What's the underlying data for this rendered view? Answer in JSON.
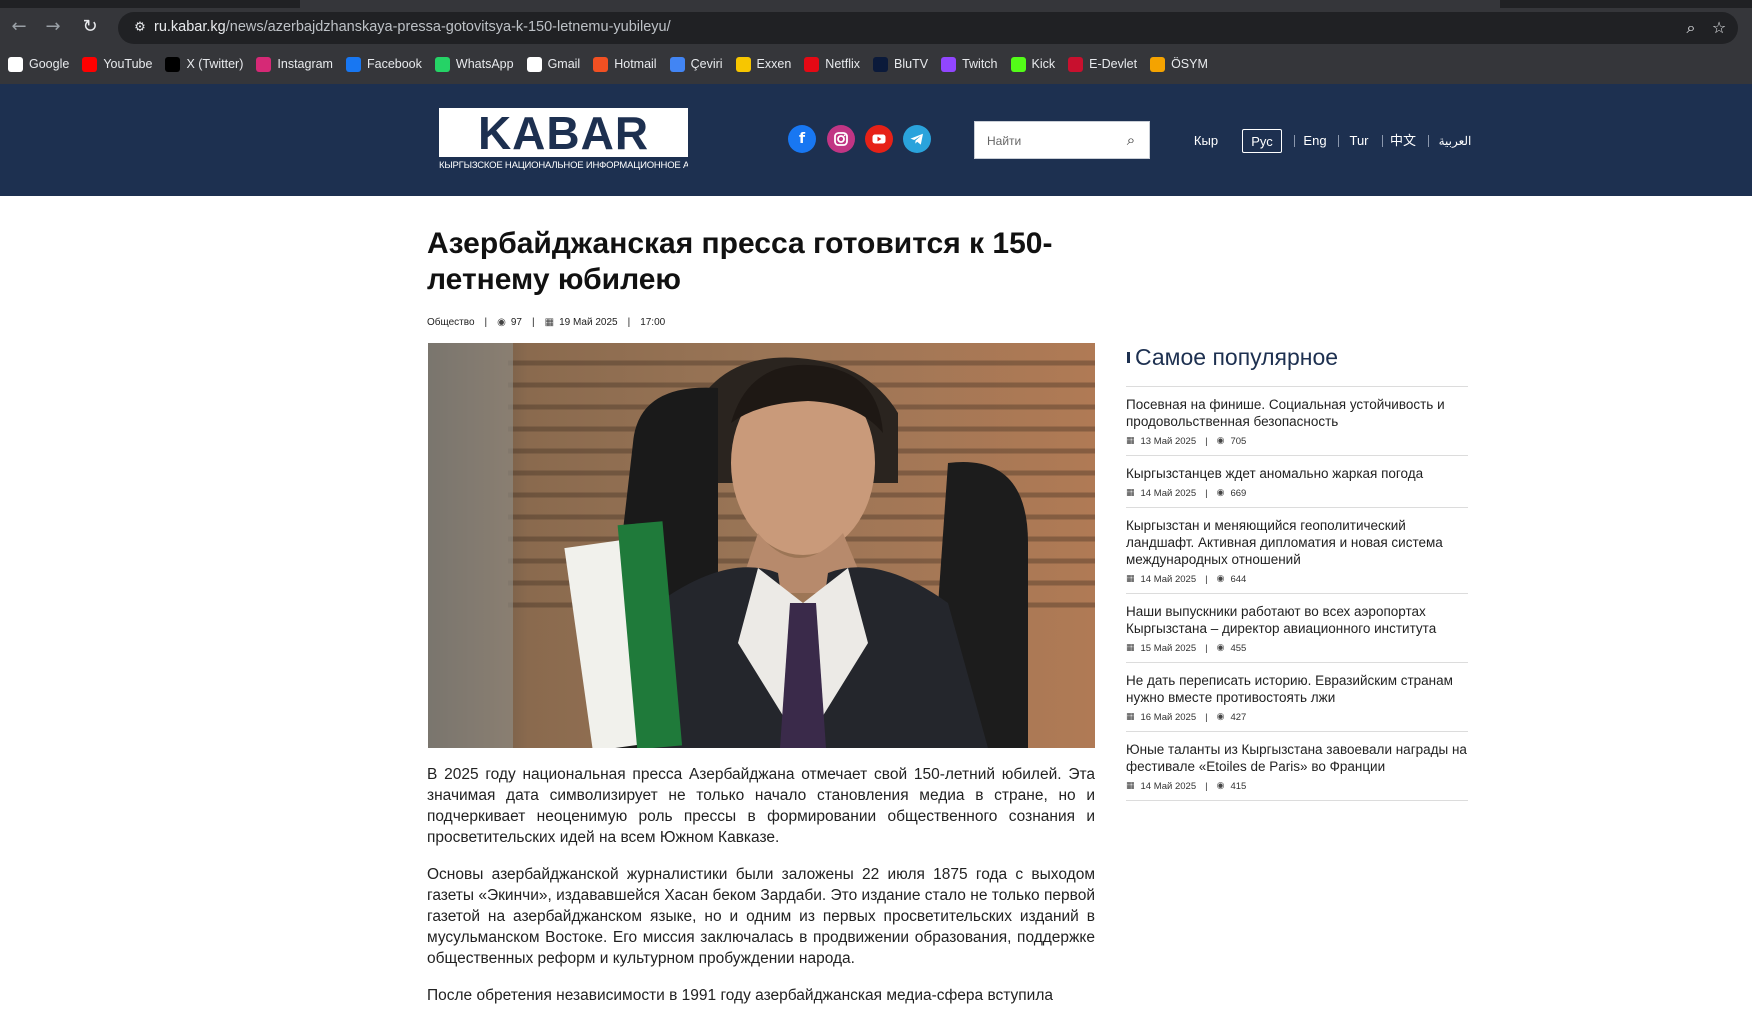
{
  "browser": {
    "url_host": "ru.kabar.kg",
    "url_path": "/news/azerbajdzhanskaya-pressa-gotovitsya-k-150-letnemu-yubileyu/",
    "bookmarks": [
      {
        "label": "Google",
        "icon": "google-icon",
        "color": "#ffffff"
      },
      {
        "label": "YouTube",
        "icon": "youtube-icon",
        "color": "#ff0000"
      },
      {
        "label": "X (Twitter)",
        "icon": "x-icon",
        "color": "#000000"
      },
      {
        "label": "Instagram",
        "icon": "instagram-icon",
        "color": "#d62976"
      },
      {
        "label": "Facebook",
        "icon": "facebook-icon",
        "color": "#1877f2"
      },
      {
        "label": "WhatsApp",
        "icon": "whatsapp-icon",
        "color": "#25d366"
      },
      {
        "label": "Gmail",
        "icon": "gmail-icon",
        "color": "#ffffff"
      },
      {
        "label": "Hotmail",
        "icon": "hotmail-icon",
        "color": "#f25022"
      },
      {
        "label": "Çeviri",
        "icon": "translate-icon",
        "color": "#4285f4"
      },
      {
        "label": "Exxen",
        "icon": "exxen-icon",
        "color": "#f7c600"
      },
      {
        "label": "Netflix",
        "icon": "netflix-icon",
        "color": "#e50914"
      },
      {
        "label": "BluTV",
        "icon": "blutv-icon",
        "color": "#0b1a3a"
      },
      {
        "label": "Twitch",
        "icon": "twitch-icon",
        "color": "#9146ff"
      },
      {
        "label": "Kick",
        "icon": "kick-icon",
        "color": "#53fc18"
      },
      {
        "label": "E-Devlet",
        "icon": "edevlet-icon",
        "color": "#c8102e"
      },
      {
        "label": "ÖSYM",
        "icon": "osym-icon",
        "color": "#f5a300"
      }
    ]
  },
  "header": {
    "logo": "KABAR",
    "logo_subtitle": "КЫРГЫЗСКОЕ НАЦИОНАЛЬНОЕ ИНФОРМАЦИОННОЕ АГЕНТСТВО",
    "search_placeholder": "Найти",
    "languages": [
      "Кыр",
      "Рус",
      "Eng",
      "Tur",
      "中文",
      "العربية"
    ],
    "active_language": "Рус",
    "colors": {
      "header_bg": "#1d3050",
      "facebook": "#1877f2",
      "instagram": "#c13584",
      "youtube": "#e62117",
      "telegram": "#2aa3dc"
    }
  },
  "article": {
    "title": "Азербайджанская пресса готовится к 150-летнему юбилею",
    "category": "Общество",
    "views": "97",
    "date": "19 Май 2025",
    "time": "17:00",
    "paragraphs": [
      "В 2025 году национальная пресса Азербайджана отмечает свой 150-летний юбилей. Эта значимая дата символизирует не только начало становления медиа в стране, но и подчеркивает неоценимую роль прессы в формировании общественного сознания и просветительских идей на всем Южном Кавказе.",
      "Основы азербайджанской журналистики были заложены 22 июля 1875 года с выходом газеты «Экинчи», издававшейся Хасан беком Зардаби. Это издание стало не только первой газетой на азербайджанском языке, но и одним из первых просветительских изданий в мусульманском Востоке. Его миссия заключалась в продвижении образования, поддержке общественных реформ и культурном пробуждении народа.",
      "После обретения независимости в 1991 году азербайджанская медиа-сфера вступила"
    ]
  },
  "sidebar": {
    "title": "Самое популярное",
    "items": [
      {
        "title": "Посевная на финише. Социальная устойчивость и продовольственная безопасность",
        "date": "13 Май 2025",
        "views": "705"
      },
      {
        "title": "Кыргызстанцев ждет аномально жаркая погода",
        "date": "14 Май 2025",
        "views": "669"
      },
      {
        "title": "Кыргызстан и меняющийся геополитический ландшафт. Активная дипломатия и новая система международных отношений",
        "date": "14 Май 2025",
        "views": "644"
      },
      {
        "title": "Наши выпускники работают во всех аэропортах Кыргызстана – директор авиационного института",
        "date": "15 Май 2025",
        "views": "455"
      },
      {
        "title": "Не дать переписать историю. Евразийским странам нужно вместе противостоять лжи",
        "date": "16 Май 2025",
        "views": "427"
      },
      {
        "title": "Юные таланты из Кыргызстана завоевали награды на фестивале «Etoiles de Paris» во Франции",
        "date": "14 Май 2025",
        "views": "415"
      }
    ]
  }
}
